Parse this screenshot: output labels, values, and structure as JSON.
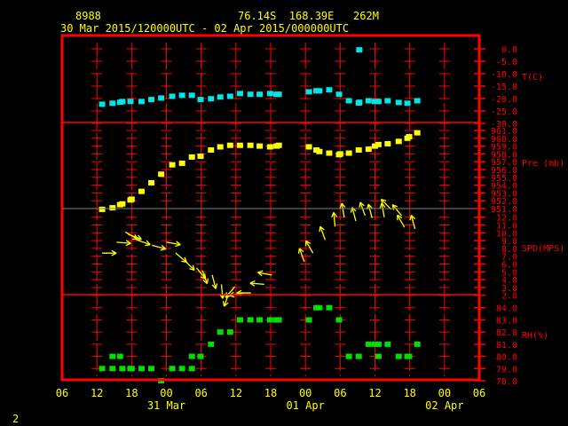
{
  "header": {
    "station_id": "8988",
    "location": "76.14S  168.39E   262M",
    "period": "30 Mar 2015/120000UTC - 02 Apr 2015/000000UTC"
  },
  "footer": {
    "page_number": "2"
  },
  "colors": {
    "frame": "#ff0000",
    "text": "#ffff00",
    "temp": "#00e5e5",
    "pres": "#ffff00",
    "wind": "#ffff00",
    "rh": "#00e000"
  },
  "chart_data": {
    "type": "scatter",
    "title": "30 Mar 2015/120000UTC - 02 Apr 2015/000000UTC",
    "x_units": "hours since 30 Mar 2015 12:00 UTC",
    "xlim": [
      -6,
      66
    ],
    "x_ticks": [
      {
        "h": -6,
        "label": "06"
      },
      {
        "h": 0,
        "label": "12"
      },
      {
        "h": 6,
        "label": "18"
      },
      {
        "h": 12,
        "label": "00"
      },
      {
        "h": 18,
        "label": "06"
      },
      {
        "h": 24,
        "label": "12"
      },
      {
        "h": 30,
        "label": "18"
      },
      {
        "h": 36,
        "label": "00"
      },
      {
        "h": 42,
        "label": "06"
      },
      {
        "h": 48,
        "label": "12"
      },
      {
        "h": 54,
        "label": "18"
      },
      {
        "h": 60,
        "label": "00"
      },
      {
        "h": 66,
        "label": "06"
      }
    ],
    "date_labels": [
      {
        "h": 12,
        "label": "31 Mar"
      },
      {
        "h": 36,
        "label": "01 Apr"
      },
      {
        "h": 60,
        "label": "02 Apr"
      }
    ],
    "panels": [
      {
        "name": "temperature",
        "ylabel": "T(C)",
        "ylim": [
          -30,
          0
        ],
        "ticks": [
          "0.0",
          "-5.0",
          "-10.0",
          "-15.0",
          "-20.0",
          "-25.0",
          "-30.0"
        ],
        "points": [
          [
            0.9,
            -22.3
          ],
          [
            2.7,
            -21.9
          ],
          [
            4.0,
            -21.5
          ],
          [
            4.4,
            -21.2
          ],
          [
            5.8,
            -21.2
          ],
          [
            7.7,
            -21.2
          ],
          [
            9.4,
            -20.4
          ],
          [
            11.1,
            -19.8
          ],
          [
            13.0,
            -19.1
          ],
          [
            14.7,
            -18.7
          ],
          [
            16.4,
            -18.7
          ],
          [
            17.9,
            -20.4
          ],
          [
            19.7,
            -20.1
          ],
          [
            21.3,
            -19.4
          ],
          [
            23.0,
            -19.1
          ],
          [
            24.7,
            -18.0
          ],
          [
            26.5,
            -18.3
          ],
          [
            28.1,
            -18.3
          ],
          [
            29.9,
            -18.0
          ],
          [
            31.0,
            -18.3
          ],
          [
            31.4,
            -18.3
          ],
          [
            36.6,
            -17.3
          ],
          [
            37.9,
            -16.9
          ],
          [
            38.4,
            -16.9
          ],
          [
            40.1,
            -16.5
          ],
          [
            41.8,
            -18.3
          ],
          [
            43.5,
            -20.9
          ],
          [
            45.2,
            -21.8
          ],
          [
            45.3,
            -21.5
          ],
          [
            45.3,
            -0.4
          ],
          [
            46.9,
            -20.9
          ],
          [
            48.0,
            -21.2
          ],
          [
            48.6,
            -21.2
          ],
          [
            50.2,
            -20.9
          ],
          [
            52.1,
            -21.6
          ],
          [
            53.6,
            -21.9
          ],
          [
            55.3,
            -20.9
          ]
        ]
      },
      {
        "name": "pressure",
        "ylabel": "Pre (mb)",
        "ylim": [
          951,
          961
        ],
        "ticks": [
          "961.0",
          "960.0",
          "959.0",
          "958.0",
          "957.0",
          "956.0",
          "955.0",
          "954.0",
          "953.0",
          "952.0",
          "951.0"
        ],
        "points": [
          [
            0.9,
            950.9
          ],
          [
            2.7,
            951.1
          ],
          [
            4.0,
            951.5
          ],
          [
            4.4,
            951.6
          ],
          [
            5.8,
            952.1
          ],
          [
            6.0,
            952.2
          ],
          [
            7.7,
            953.2
          ],
          [
            9.4,
            954.3
          ],
          [
            11.1,
            955.4
          ],
          [
            13.0,
            956.6
          ],
          [
            14.7,
            956.8
          ],
          [
            16.4,
            957.6
          ],
          [
            17.9,
            957.7
          ],
          [
            19.7,
            958.5
          ],
          [
            21.3,
            958.9
          ],
          [
            23.0,
            959.1
          ],
          [
            24.7,
            959.1
          ],
          [
            26.5,
            959.1
          ],
          [
            28.1,
            959.0
          ],
          [
            29.9,
            958.9
          ],
          [
            31.0,
            959.0
          ],
          [
            31.4,
            959.1
          ],
          [
            36.6,
            958.9
          ],
          [
            37.9,
            958.5
          ],
          [
            38.4,
            958.3
          ],
          [
            40.1,
            958.1
          ],
          [
            41.8,
            957.9
          ],
          [
            42.0,
            958.0
          ],
          [
            43.5,
            958.1
          ],
          [
            45.2,
            958.5
          ],
          [
            46.9,
            958.6
          ],
          [
            48.0,
            959.0
          ],
          [
            48.6,
            959.2
          ],
          [
            50.2,
            959.3
          ],
          [
            52.1,
            959.6
          ],
          [
            53.6,
            960.0
          ],
          [
            53.9,
            960.2
          ],
          [
            55.3,
            960.7
          ]
        ]
      },
      {
        "name": "wind",
        "ylabel": "SPD(MPS)",
        "ylim": [
          2,
          12
        ],
        "ticks": [
          "12.0",
          "11.0",
          "10.0",
          "9.0",
          "8.0",
          "7.0",
          "6.0",
          "5.0",
          "4.0",
          "3.0",
          "2.0"
        ],
        "points_speed_dirfrom": [
          [
            0.9,
            7.4,
            270
          ],
          [
            3.4,
            8.8,
            275
          ],
          [
            4.9,
            10.1,
            300
          ],
          [
            5.4,
            9.8,
            290
          ],
          [
            6.9,
            9.1,
            290
          ],
          [
            9.5,
            8.4,
            285
          ],
          [
            12.0,
            8.8,
            280
          ],
          [
            13.6,
            7.4,
            310
          ],
          [
            15.1,
            6.5,
            315
          ],
          [
            17.2,
            5.5,
            320
          ],
          [
            18.2,
            5.2,
            340
          ],
          [
            19.9,
            4.6,
            345
          ],
          [
            21.5,
            3.4,
            355
          ],
          [
            22.8,
            2.3,
            20
          ],
          [
            23.8,
            3.1,
            40
          ],
          [
            25.3,
            2.3,
            80
          ],
          [
            26.6,
            2.3,
            90
          ],
          [
            28.9,
            3.4,
            95
          ],
          [
            30.2,
            4.6,
            100
          ],
          [
            35.8,
            6.3,
            160
          ],
          [
            37.3,
            7.4,
            150
          ],
          [
            39.4,
            9.1,
            160
          ],
          [
            41.1,
            10.8,
            175
          ],
          [
            42.7,
            12.0,
            170
          ],
          [
            44.7,
            11.5,
            165
          ],
          [
            46.3,
            12.2,
            160
          ],
          [
            47.5,
            11.9,
            165
          ],
          [
            49.6,
            12.0,
            170
          ],
          [
            50.8,
            13.0,
            135
          ],
          [
            52.6,
            12.2,
            140
          ],
          [
            53.1,
            10.7,
            150
          ],
          [
            54.9,
            10.5,
            165
          ]
        ]
      },
      {
        "name": "humidity",
        "ylabel": "RH(%)",
        "ylim": [
          78,
          84
        ],
        "ticks": [
          "84.0",
          "83.0",
          "82.0",
          "81.0",
          "80.0",
          "79.0",
          "78.0"
        ],
        "points": [
          [
            0.9,
            79
          ],
          [
            2.7,
            80
          ],
          [
            2.7,
            79
          ],
          [
            4.0,
            80
          ],
          [
            4.4,
            79
          ],
          [
            5.8,
            79
          ],
          [
            6.0,
            79
          ],
          [
            7.7,
            79
          ],
          [
            9.4,
            79
          ],
          [
            11.1,
            78
          ],
          [
            13.0,
            79
          ],
          [
            14.7,
            79
          ],
          [
            16.4,
            79
          ],
          [
            16.4,
            80
          ],
          [
            17.9,
            80
          ],
          [
            19.7,
            81
          ],
          [
            21.3,
            82
          ],
          [
            23.0,
            82
          ],
          [
            24.7,
            83
          ],
          [
            26.5,
            83
          ],
          [
            28.1,
            83
          ],
          [
            29.9,
            83
          ],
          [
            31.0,
            83
          ],
          [
            31.4,
            83
          ],
          [
            36.6,
            83
          ],
          [
            37.9,
            84
          ],
          [
            38.4,
            84
          ],
          [
            40.1,
            84
          ],
          [
            41.8,
            83
          ],
          [
            43.5,
            80
          ],
          [
            45.2,
            80
          ],
          [
            46.9,
            81
          ],
          [
            48.0,
            81
          ],
          [
            48.6,
            81
          ],
          [
            48.6,
            80
          ],
          [
            50.2,
            81
          ],
          [
            52.1,
            80
          ],
          [
            53.6,
            80
          ],
          [
            53.9,
            80
          ],
          [
            55.3,
            81
          ]
        ]
      }
    ]
  }
}
